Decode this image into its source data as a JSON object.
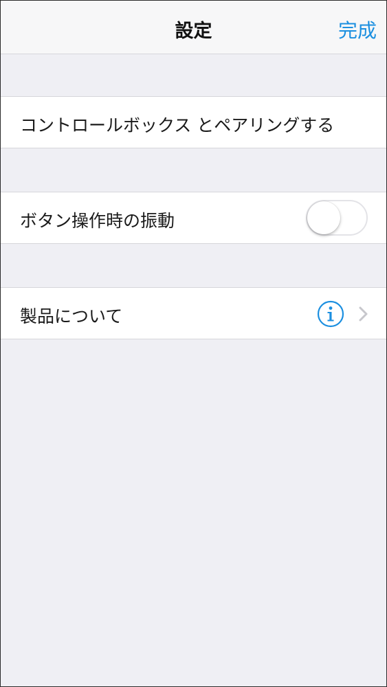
{
  "navbar": {
    "title": "設定",
    "done_label": "完成"
  },
  "rows": [
    {
      "label": "コントロールボックス とペアリングする"
    },
    {
      "label": "ボタン操作時の振動",
      "toggle_on": false
    },
    {
      "label": "製品について"
    }
  ],
  "colors": {
    "accent": "#1b8fe0",
    "background": "#efeff4",
    "row_background": "#ffffff",
    "separator": "#d6d6da",
    "chevron": "#c7c7cc"
  },
  "icons": {
    "info": "info-icon",
    "chevron": "chevron-right-icon"
  }
}
